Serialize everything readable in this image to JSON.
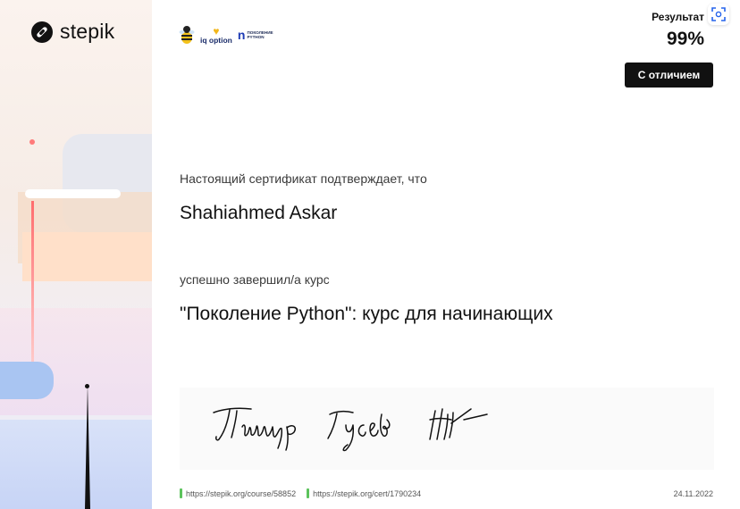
{
  "brand": {
    "logo_text": "stepik"
  },
  "partners": {
    "iq_label": "iq option",
    "pp_mark": "n",
    "pp_line1": "ПОКОЛЕНИЕ",
    "pp_line2": "PYTHON"
  },
  "result": {
    "label": "Результат",
    "value": "99%",
    "badge": "С отличием"
  },
  "certificate": {
    "intro": "Настоящий сертификат подтверждает, что",
    "recipient": "Shahiahmed Askar",
    "completed": "успешно завершил/а  курс",
    "course": "\"Поколение Python\": курс для начинающих"
  },
  "signature": {
    "line1": "Тимур Гусев",
    "initials": "ТГ/"
  },
  "footer": {
    "course_url": "https://stepik.org/course/58852",
    "cert_url": "https://stepik.org/cert/1790234",
    "date": "24.11.2022"
  },
  "colors": {
    "accent_green": "#5cc35c",
    "badge_bg": "#111111"
  }
}
